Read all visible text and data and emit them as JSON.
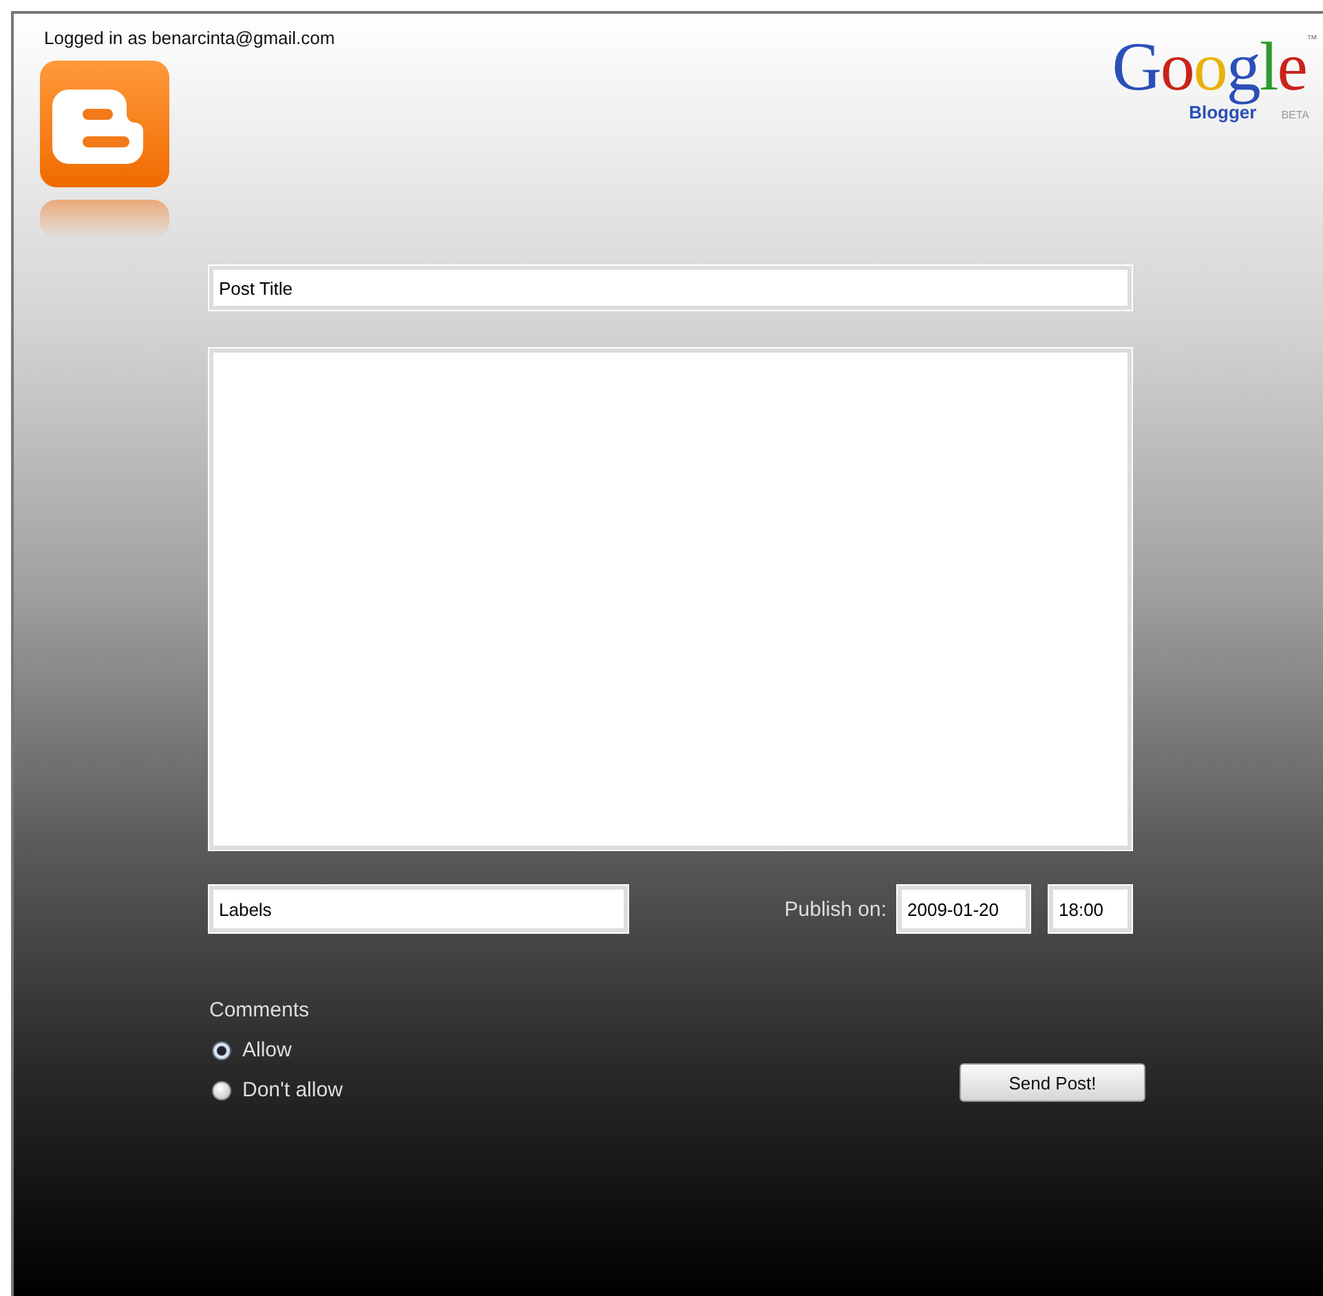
{
  "header": {
    "login_text": "Logged in as benarcinta@gmail.com",
    "brand": {
      "word": "Google",
      "trademark": "™",
      "product": "Blogger",
      "stage": "BETA"
    }
  },
  "form": {
    "title_field": {
      "value": "Post Title"
    },
    "labels_field": {
      "value": "Labels"
    },
    "publish_label": "Publish on:",
    "date_field": {
      "value": "2009-01-20"
    },
    "time_field": {
      "value": "18:00"
    },
    "comments_label": "Comments",
    "comment_options": [
      {
        "label": "Allow",
        "selected": true
      },
      {
        "label": "Don't allow",
        "selected": false
      }
    ],
    "submit_button": "Send Post!"
  }
}
